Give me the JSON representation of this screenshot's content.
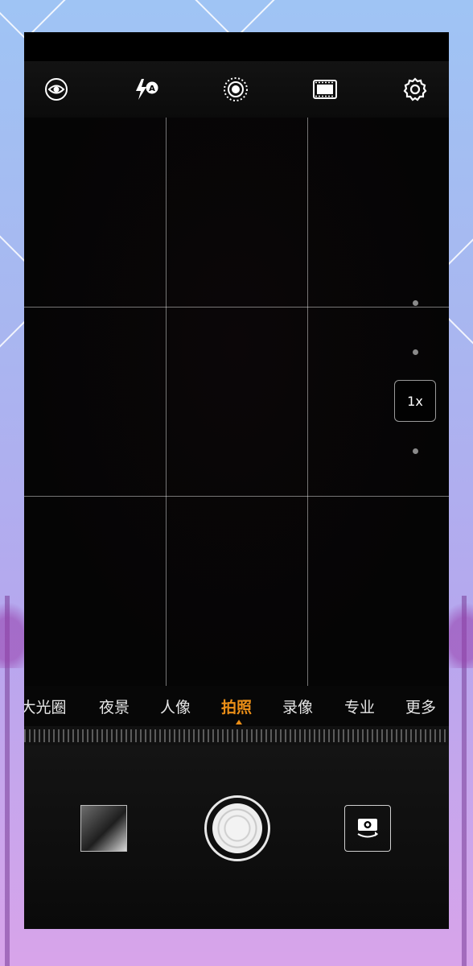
{
  "toolbar": {
    "icons": [
      "aperture-eye-icon",
      "flash-auto-icon",
      "live-photo-icon",
      "film-icon",
      "settings-gear-icon"
    ]
  },
  "zoom": {
    "label": "1x"
  },
  "modes": {
    "items": [
      "大光圈",
      "夜景",
      "人像",
      "拍照",
      "录像",
      "专业",
      "更多"
    ],
    "active": "拍照"
  },
  "colors": {
    "accent": "#ec8f17",
    "background": "#000000"
  }
}
